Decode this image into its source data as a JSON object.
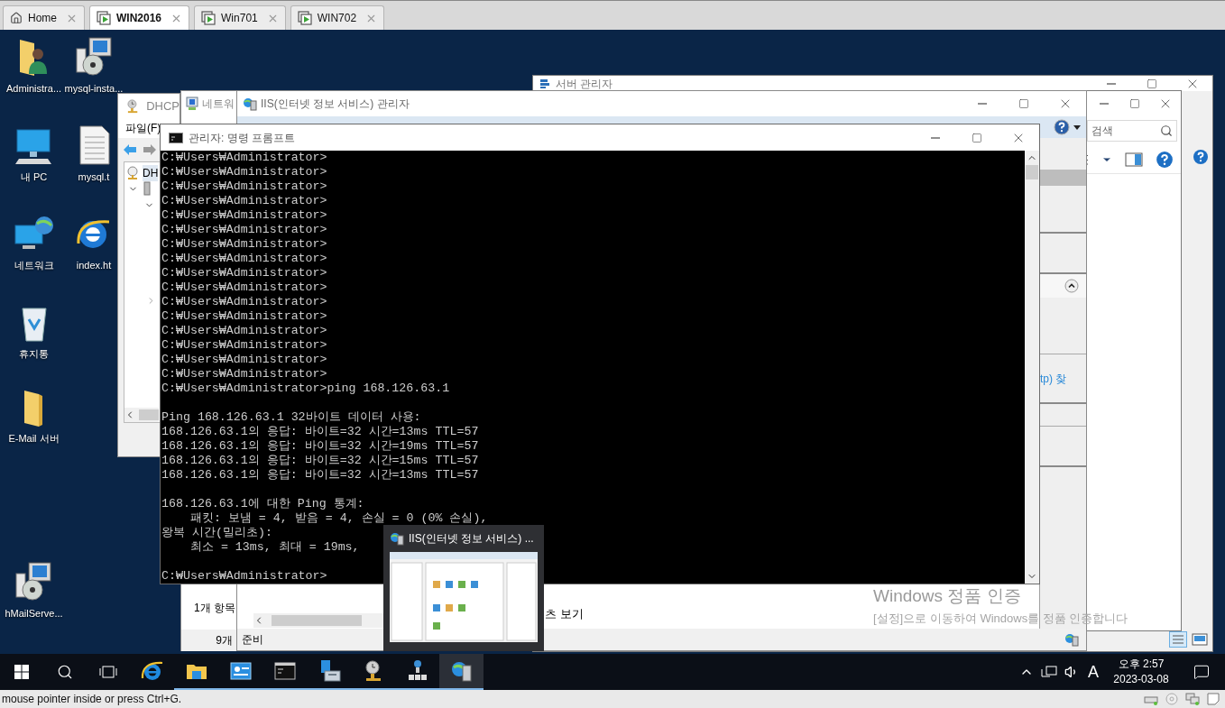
{
  "vm_tabs": [
    {
      "label": "Home",
      "kind": "home",
      "selected": false
    },
    {
      "label": "WIN2016",
      "kind": "vm",
      "selected": true
    },
    {
      "label": "Win701",
      "kind": "vm",
      "selected": false
    },
    {
      "label": "WIN702",
      "kind": "vm",
      "selected": false
    }
  ],
  "desktop_columns": [
    [
      {
        "label": "Administra...",
        "kind": "user-folder"
      },
      {
        "label": "내 PC",
        "kind": "pc"
      },
      {
        "label": "네트워크",
        "kind": "network"
      },
      {
        "label": "휴지통",
        "kind": "recycle-bin"
      },
      {
        "label": "E-Mail 서버",
        "kind": "folder"
      },
      {
        "label": "hMailServe...",
        "kind": "installer"
      }
    ],
    [
      {
        "label": "mysql-insta...",
        "kind": "installer"
      },
      {
        "label": "mysql.t",
        "kind": "text-file"
      },
      {
        "label": "index.ht",
        "kind": "browser"
      }
    ]
  ],
  "server_manager": {
    "title": "서버 관리자"
  },
  "explorer": {
    "search": {
      "placeholder": "검색"
    }
  },
  "dhcp": {
    "title": "DHCP",
    "menu": "파일(F)",
    "tree_root": "DH"
  },
  "network": {
    "title": "네트워",
    "item_count": "1개 항목",
    "status": "9개"
  },
  "iis": {
    "title": "IIS(인터넷 정보 서비스) 관리자",
    "action_link": "tp) 찾",
    "view_tab": "츠 보기",
    "status": "준비"
  },
  "cmd": {
    "title": "관리자: 명령 프롬프트",
    "blocks": [
      [
        "C:₩Users₩Administrator>",
        "C:₩Users₩Administrator>",
        "C:₩Users₩Administrator>",
        "C:₩Users₩Administrator>",
        "C:₩Users₩Administrator>",
        "C:₩Users₩Administrator>",
        "C:₩Users₩Administrator>",
        "C:₩Users₩Administrator>",
        "C:₩Users₩Administrator>",
        "C:₩Users₩Administrator>",
        "C:₩Users₩Administrator>",
        "C:₩Users₩Administrator>",
        "C:₩Users₩Administrator>",
        "C:₩Users₩Administrator>",
        "C:₩Users₩Administrator>",
        "C:₩Users₩Administrator>",
        "C:₩Users₩Administrator>ping 168.126.63.1"
      ],
      [
        "Ping 168.126.63.1 32바이트 데이터 사용:",
        "168.126.63.1의 응답: 바이트=32 시간=13ms TTL=57",
        "168.126.63.1의 응답: 바이트=32 시간=19ms TTL=57",
        "168.126.63.1의 응답: 바이트=32 시간=15ms TTL=57",
        "168.126.63.1의 응답: 바이트=32 시간=13ms TTL=57"
      ],
      [
        "168.126.63.1에 대한 Ping 통계:",
        "    패킷: 보냄 = 4, 받음 = 4, 손실 = 0 (0% 손실),",
        "왕복 시간(밀리초):",
        "    최소 = 13ms, 최대 = 19ms,"
      ],
      [
        "C:₩Users₩Administrator>"
      ]
    ]
  },
  "activation": {
    "title": "Windows 정품 인증",
    "message": "[설정]으로 이동하여 Windows를 정품 인증합니다"
  },
  "preview": {
    "title": "IIS(인터넷 정보 서비스) ..."
  },
  "taskbar": {
    "apps": [
      {
        "kind": "ie",
        "open": false,
        "selected": false
      },
      {
        "kind": "explorer",
        "open": true,
        "selected": false
      },
      {
        "kind": "dashboard",
        "open": true,
        "selected": false
      },
      {
        "kind": "cmd",
        "open": true,
        "selected": false
      },
      {
        "kind": "server",
        "open": true,
        "selected": false
      },
      {
        "kind": "dhcp",
        "open": true,
        "selected": false
      },
      {
        "kind": "network",
        "open": true,
        "selected": false
      },
      {
        "kind": "iis",
        "open": true,
        "selected": true
      }
    ],
    "ime": "A",
    "time": "오후 2:57",
    "date": "2023-03-08"
  },
  "vm_status": {
    "message": "mouse pointer inside or press Ctrl+G."
  }
}
